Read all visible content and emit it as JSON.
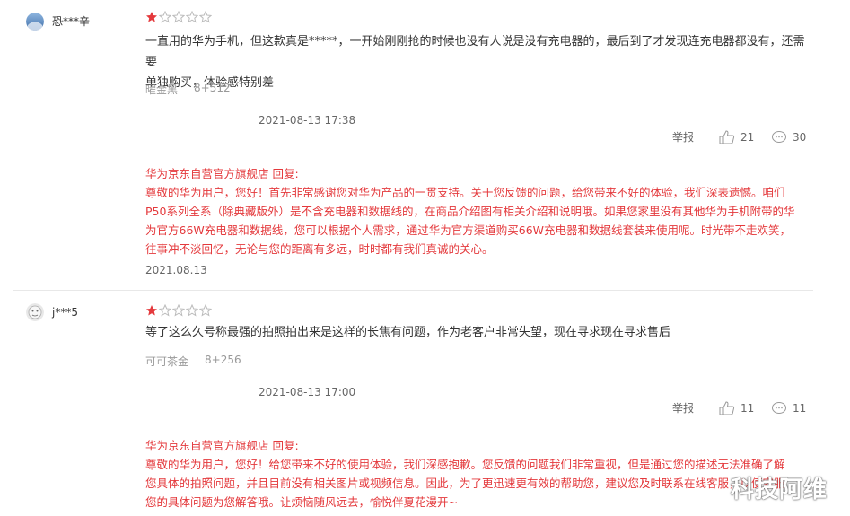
{
  "reviews": [
    {
      "username": "恐***辛",
      "rating": 1,
      "max_rating": 5,
      "comment_lines": [
        "一直用的华为手机，但这款真是*****，一开始刚刚抢的时候也没有人说是没有充电器的，最后到了才发现连充电器都没有，还需要",
        "单独购买，体验感特别差"
      ],
      "color_variant": "曜金黑",
      "storage": "8+512",
      "time": "2021-08-13 17:38",
      "report_label": "举报",
      "likes": "21",
      "replies": "30",
      "reply": {
        "title": "华为京东自营官方旗舰店 回复:",
        "lines": [
          "尊敬的华为用户，您好！首先非常感谢您对华为产品的一贯支持。关于您反馈的问题，给您带来不好的体验，我们深表遗憾。咱们",
          "P50系列全系（除典藏版外）是不含充电器和数据线的，在商品介绍图有相关介绍和说明哦。如果您家里没有其他华为手机附带的华",
          "为官方66W充电器和数据线，您可以根据个人需求，通过华为官方渠道购买66W充电器和数据线套装来使用呢。时光带不走欢笑，",
          "往事冲不淡回忆，无论与您的距离有多远，时时都有我们真诚的关心。"
        ],
        "date": "2021.08.13"
      }
    },
    {
      "username": "j***5",
      "rating": 1,
      "max_rating": 5,
      "comment_lines": [
        "等了这么久号称最强的拍照拍出来是这样的长焦有问题，作为老客户非常失望，现在寻求现在寻求售后"
      ],
      "color_variant": "可可茶金",
      "storage": "8+256",
      "time": "2021-08-13 17:00",
      "report_label": "举报",
      "likes": "11",
      "replies": "11",
      "reply": {
        "title": "华为京东自营官方旗舰店 回复:",
        "lines": [
          "尊敬的华为用户，您好！给您带来不好的使用体验，我们深感抱歉。您反馈的问题我们非常重视，但是通过您的描述无法准确了解",
          "您具体的拍照问题，并且目前没有相关图片或视频信息。因此，为了更迅速更有效的帮助您，建议您及时联系在线客服，以便客服",
          "您的具体问题为您解答哦。让烦恼随风远去，愉悦伴夏花漫开~"
        ]
      }
    }
  ],
  "watermark": "科技阿维",
  "colors": {
    "star_filled": "#e4393c",
    "reply_text": "#e4393c"
  }
}
